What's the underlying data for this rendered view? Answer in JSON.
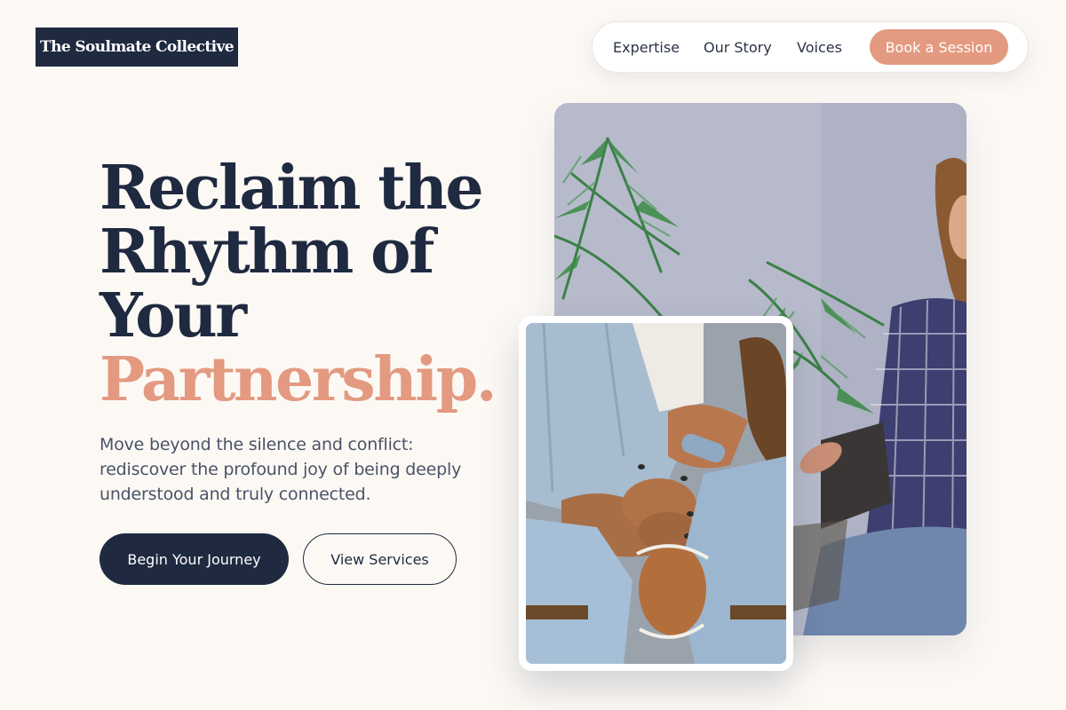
{
  "brand": {
    "name": "The Soulmate Collective"
  },
  "nav": {
    "links": [
      "Expertise",
      "Our Story",
      "Voices"
    ],
    "cta": "Book a Session"
  },
  "hero": {
    "title_lines": [
      "Reclaim the",
      "Rhythm of",
      "Your"
    ],
    "title_accent": "Partnership.",
    "subtitle": "Move beyond the silence and conflict: rediscover the profound joy of being deeply understood and truly connected.",
    "primary_button": "Begin Your Journey",
    "secondary_button": "View Services"
  },
  "images": {
    "large": {
      "icon": "couple-therapy-photo"
    },
    "small": {
      "icon": "holding-hands-photo"
    }
  },
  "colors": {
    "navy": "#1f2a40",
    "accent": "#e39a80",
    "background": "#fcf9f5"
  }
}
